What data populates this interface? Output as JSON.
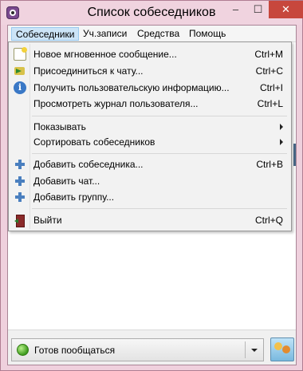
{
  "window": {
    "title": "Список собеседников"
  },
  "menubar": {
    "items": [
      {
        "label": "Собеседники"
      },
      {
        "label": "Уч.записи"
      },
      {
        "label": "Средства"
      },
      {
        "label": "Помощь"
      }
    ]
  },
  "dropdown": {
    "items": [
      {
        "label": "Новое мгновенное сообщение...",
        "shortcut": "Ctrl+M",
        "icon": "new-message-icon"
      },
      {
        "label": "Присоединиться к чату...",
        "shortcut": "Ctrl+C",
        "icon": "join-chat-icon"
      },
      {
        "label": "Получить пользовательскую информацию...",
        "shortcut": "Ctrl+I",
        "icon": "info-icon"
      },
      {
        "label": "Просмотреть журнал пользователя...",
        "shortcut": "Ctrl+L",
        "icon": ""
      },
      {
        "label": "Показывать",
        "shortcut": "",
        "icon": "",
        "submenu": true
      },
      {
        "label": "Сортировать собеседников",
        "shortcut": "",
        "icon": "",
        "submenu": true
      },
      {
        "label": "Добавить собеседника...",
        "shortcut": "Ctrl+B",
        "icon": "add-icon"
      },
      {
        "label": "Добавить чат...",
        "shortcut": "",
        "icon": "add-icon"
      },
      {
        "label": "Добавить группу...",
        "shortcut": "",
        "icon": "add-icon"
      },
      {
        "label": "Выйти",
        "shortcut": "Ctrl+Q",
        "icon": "exit-icon"
      }
    ]
  },
  "status": {
    "label": "Готов пообщаться"
  },
  "titlebar_buttons": {
    "minimize": "–",
    "maximize": "☐",
    "close": "✕"
  },
  "colors": {
    "accent_active_menu": "#cce4f7",
    "close_button": "#c7473d",
    "status_online": "#3d9b1d"
  }
}
